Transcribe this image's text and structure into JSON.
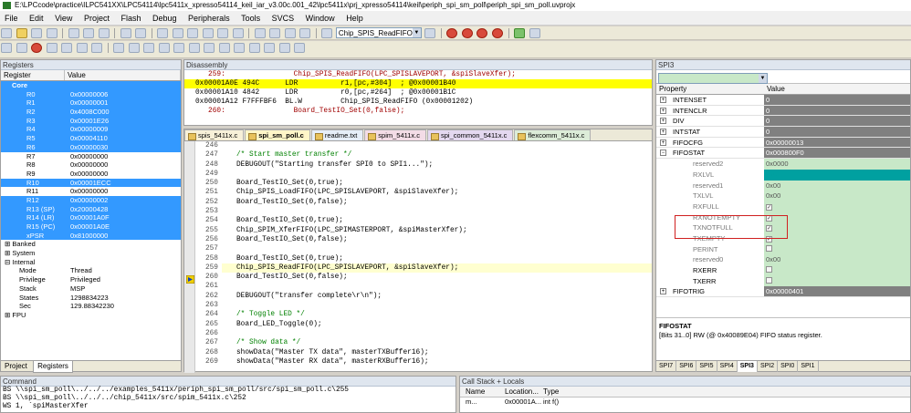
{
  "window": {
    "title": "E:\\LPCcode\\practice\\ILPC541XX\\LPC54114\\lpc5411x_xpresso54114_keil_iar_v3.00c.001_42\\lpc5411x\\prj_xpresso54114\\keil\\periph_spi_sm_poll\\periph_spi_sm_poll.uvprojx"
  },
  "menu": [
    "File",
    "Edit",
    "View",
    "Project",
    "Flash",
    "Debug",
    "Peripherals",
    "Tools",
    "SVCS",
    "Window",
    "Help"
  ],
  "toolbar": {
    "function_combo": "Chip_SPIS_ReadFIFO"
  },
  "registers": {
    "panel_title": "Registers",
    "col_register": "Register",
    "col_value": "Value",
    "core_label": "Core",
    "rows": [
      {
        "name": "R0",
        "value": "0x00000006",
        "sel": true
      },
      {
        "name": "R1",
        "value": "0x00000001",
        "sel": true
      },
      {
        "name": "R2",
        "value": "0x4008C000",
        "sel": true
      },
      {
        "name": "R3",
        "value": "0x00001E26",
        "sel": true
      },
      {
        "name": "R4",
        "value": "0x00000009",
        "sel": true
      },
      {
        "name": "R5",
        "value": "0x00004110",
        "sel": true
      },
      {
        "name": "R6",
        "value": "0x00000030",
        "sel": true
      },
      {
        "name": "R7",
        "value": "0x00000000",
        "sel": false
      },
      {
        "name": "R8",
        "value": "0x00000000",
        "sel": false
      },
      {
        "name": "R9",
        "value": "0x00000000",
        "sel": false
      },
      {
        "name": "R10",
        "value": "0x00001ECC",
        "sel": true
      },
      {
        "name": "R11",
        "value": "0x00000000",
        "sel": false
      },
      {
        "name": "R12",
        "value": "0x00000002",
        "sel": true
      },
      {
        "name": "R13 (SP)",
        "value": "0x20000428",
        "sel": true
      },
      {
        "name": "R14 (LR)",
        "value": "0x00001A0F",
        "sel": true
      },
      {
        "name": "R15 (PC)",
        "value": "0x00001A0E",
        "sel": true
      },
      {
        "name": "xPSR",
        "value": "0x81000000",
        "sel": true
      }
    ],
    "groups": [
      "Banked",
      "System",
      "Internal"
    ],
    "internal": [
      {
        "name": "Mode",
        "value": "Thread"
      },
      {
        "name": "Privilege",
        "value": "Privileged"
      },
      {
        "name": "Stack",
        "value": "MSP"
      },
      {
        "name": "States",
        "value": "1298834223"
      },
      {
        "name": "Sec",
        "value": "129.88342230"
      }
    ],
    "fpu_label": "FPU",
    "tab_project": "Project",
    "tab_registers": "Registers"
  },
  "disassembly": {
    "panel_title": "Disassembly",
    "lines": [
      {
        "text": "   259:                Chip_SPIS_ReadFIFO(LPC_SPISLAVEPORT, &spiSlaveXfer);",
        "kind": "red"
      },
      {
        "text": "0x00001A0E 494C      LDR          r1,[pc,#304]  ; @0x00001B40",
        "kind": "hl"
      },
      {
        "text": "0x00001A10 4842      LDR          r0,[pc,#264]  ; @0x00001B1C",
        "kind": "plain"
      },
      {
        "text": "0x00001A12 F7FFFBF6  BL.W         Chip_SPIS_ReadFIFO (0x00001202)",
        "kind": "plain"
      },
      {
        "text": "   260:                Board_TestIO_Set(0,false);",
        "kind": "red"
      }
    ]
  },
  "editor": {
    "tabs": [
      "spis_5411x.c",
      "spi_sm_poll.c",
      "readme.txt",
      "spim_5411x.c",
      "spi_common_5411x.c",
      "flexcomm_5411x.c"
    ],
    "lines": [
      {
        "n": "246",
        "t": ""
      },
      {
        "n": "247",
        "t": "/* Start master transfer */",
        "c": "cm"
      },
      {
        "n": "248",
        "t": "DEBUGOUT(\"Starting transfer SPI0 to SPI1...\");"
      },
      {
        "n": "249",
        "t": ""
      },
      {
        "n": "250",
        "t": "Board_TestIO_Set(0,true);"
      },
      {
        "n": "251",
        "t": "Chip_SPIS_LoadFIFO(LPC_SPISLAVEPORT, &spiSlaveXfer);"
      },
      {
        "n": "252",
        "t": "Board_TestIO_Set(0,false);"
      },
      {
        "n": "253",
        "t": ""
      },
      {
        "n": "254",
        "t": "Board_TestIO_Set(0,true);"
      },
      {
        "n": "255",
        "t": "Chip_SPIM_XferFIFO(LPC_SPIMASTERPORT, &spiMasterXfer);"
      },
      {
        "n": "256",
        "t": "Board_TestIO_Set(0,false);"
      },
      {
        "n": "257",
        "t": ""
      },
      {
        "n": "258",
        "t": "Board_TestIO_Set(0,true);"
      },
      {
        "n": "259",
        "t": "Chip_SPIS_ReadFIFO(LPC_SPISLAVEPORT, &spiSlaveXfer);",
        "cur": true
      },
      {
        "n": "260",
        "t": "Board_TestIO_Set(0,false);"
      },
      {
        "n": "261",
        "t": ""
      },
      {
        "n": "262",
        "t": "DEBUGOUT(\"transfer complete\\r\\n\");"
      },
      {
        "n": "263",
        "t": ""
      },
      {
        "n": "264",
        "t": "/* Toggle LED */",
        "c": "cm"
      },
      {
        "n": "265",
        "t": "Board_LED_Toggle(0);"
      },
      {
        "n": "266",
        "t": ""
      },
      {
        "n": "267",
        "t": "/* Show data */",
        "c": "cm"
      },
      {
        "n": "268",
        "t": "showData(\"Master TX data\", masterTXBuffer16);"
      },
      {
        "n": "269",
        "t": "showData(\"Master RX data\", masterRXBuffer16);"
      }
    ]
  },
  "spi": {
    "panel_title": "SPI3",
    "col_property": "Property",
    "col_value": "Value",
    "rows": [
      {
        "name": "INTENSET",
        "value": "0",
        "kind": "top"
      },
      {
        "name": "INTENCLR",
        "value": "0",
        "kind": "top"
      },
      {
        "name": "DIV",
        "value": "0",
        "kind": "top"
      },
      {
        "name": "INTSTAT",
        "value": "0",
        "kind": "top"
      },
      {
        "name": "FIFOCFG",
        "value": "0x00000013",
        "kind": "top"
      },
      {
        "name": "FIFOSTAT",
        "value": "0x000800F0",
        "kind": "top",
        "open": true
      },
      {
        "name": "reserved2",
        "value": "0x0000",
        "kind": "child"
      },
      {
        "name": "RXLVL",
        "value": "0x08",
        "kind": "teal"
      },
      {
        "name": "reserved1",
        "value": "0x00",
        "kind": "child"
      },
      {
        "name": "TXLVL",
        "value": "0x00",
        "kind": "child"
      },
      {
        "name": "RXFULL",
        "value": "✓",
        "kind": "check"
      },
      {
        "name": "RXNOTEMPTY",
        "value": "✓",
        "kind": "check"
      },
      {
        "name": "TXNOTFULL",
        "value": "✓",
        "kind": "check"
      },
      {
        "name": "TXEMPTY",
        "value": "✓",
        "kind": "check"
      },
      {
        "name": "PERINT",
        "value": "",
        "kind": "check"
      },
      {
        "name": "reserved0",
        "value": "0x00",
        "kind": "child"
      },
      {
        "name": "RXERR",
        "value": "",
        "kind": "checkb"
      },
      {
        "name": "TXERR",
        "value": "",
        "kind": "checkb"
      },
      {
        "name": "FIFOTRIG",
        "value": "0x00000401",
        "kind": "top"
      }
    ],
    "desc_title": "FIFOSTAT",
    "desc_text": "[Bits 31..0] RW (@ 0x40089E04) FIFO status register.",
    "tabs": [
      "SPI7",
      "SPI6",
      "SPI5",
      "SPI4",
      "SPI3",
      "SPI2",
      "SPI0",
      "SPI1"
    ]
  },
  "command": {
    "panel_title": "Command",
    "lines": [
      "BS \\\\spi_sm_poll\\../../../examples_5411x/periph_spi_sm_poll/src/spi_sm_poll.c\\255",
      "BS \\\\spi_sm_poll\\../../../chip_5411x/src/spim_5411x.c\\252",
      "WS 1, `spiMasterXfer"
    ]
  },
  "callstack": {
    "panel_title": "Call Stack + Locals",
    "col_name": "Name",
    "col_location": "Location...",
    "col_type": "Type",
    "row": {
      "name": "m...",
      "location": "0x00001A...",
      "type": "int f()"
    }
  }
}
